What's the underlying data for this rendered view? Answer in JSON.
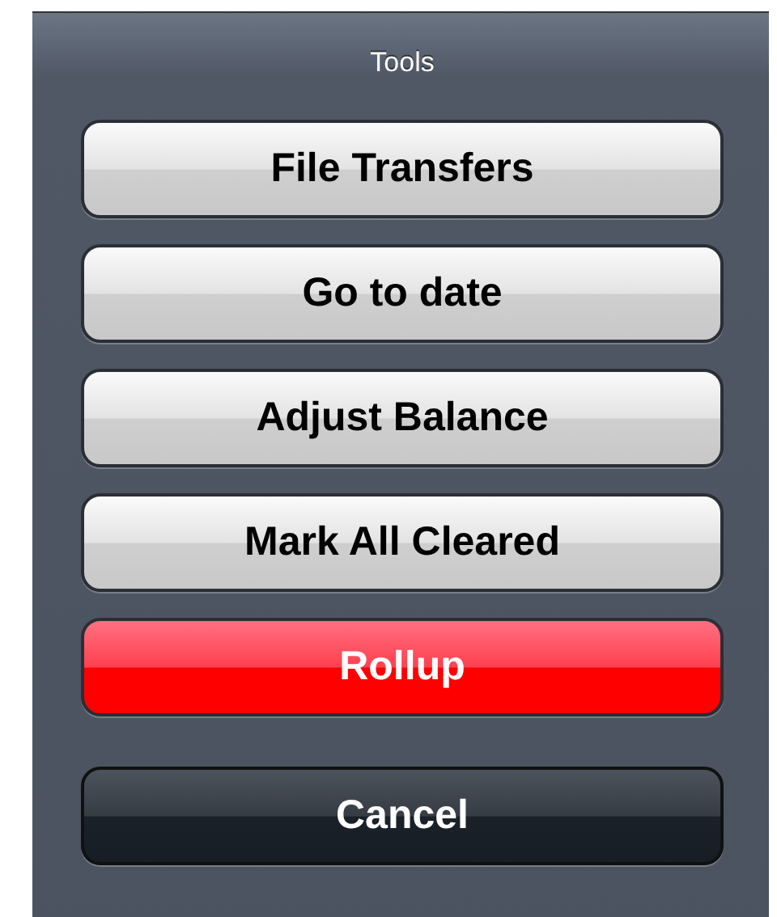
{
  "action_sheet": {
    "title": "Tools",
    "buttons": [
      {
        "label": "File Transfers",
        "kind": "default"
      },
      {
        "label": "Go to date",
        "kind": "default"
      },
      {
        "label": "Adjust Balance",
        "kind": "default"
      },
      {
        "label": "Mark All Cleared",
        "kind": "default"
      },
      {
        "label": "Rollup",
        "kind": "destructive"
      },
      {
        "label": "Cancel",
        "kind": "cancel"
      }
    ]
  }
}
